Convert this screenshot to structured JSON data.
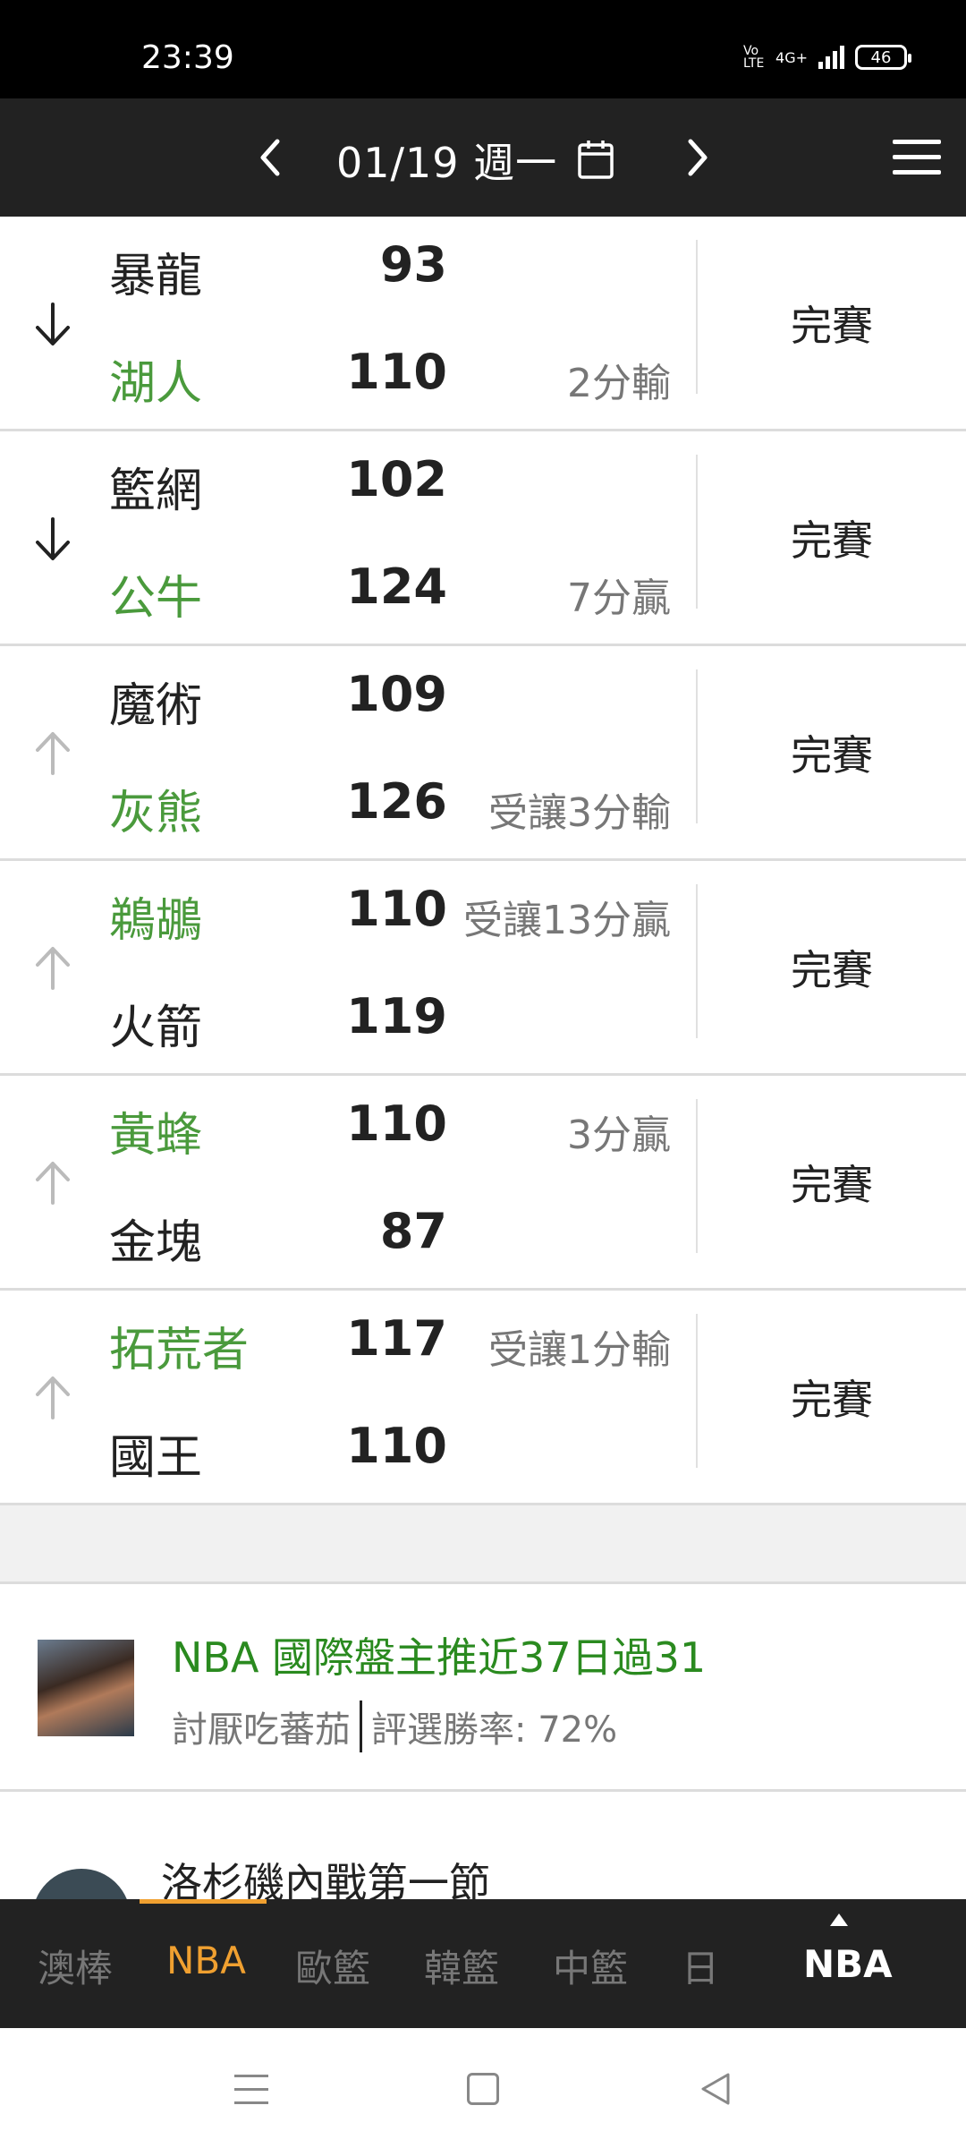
{
  "status_bar": {
    "time": "23:39",
    "network": "4G+",
    "volte": "Vo LTE",
    "battery": "46"
  },
  "header": {
    "date": "01/19 週一"
  },
  "games": [
    {
      "arrow": "down",
      "team1": "暴龍",
      "score1": "93",
      "result1": "",
      "team2": "湖人",
      "score2": "110",
      "result2": "2分輸",
      "team1_green": false,
      "team2_green": true,
      "status": "完賽"
    },
    {
      "arrow": "down",
      "team1": "籃網",
      "score1": "102",
      "result1": "",
      "team2": "公牛",
      "score2": "124",
      "result2": "7分贏",
      "team1_green": false,
      "team2_green": true,
      "status": "完賽"
    },
    {
      "arrow": "up",
      "team1": "魔術",
      "score1": "109",
      "result1": "",
      "team2": "灰熊",
      "score2": "126",
      "result2": "受讓3分輸",
      "team1_green": false,
      "team2_green": true,
      "status": "完賽"
    },
    {
      "arrow": "up",
      "team1": "鵜鶘",
      "score1": "110",
      "result1": "受讓13分贏",
      "team2": "火箭",
      "score2": "119",
      "result2": "",
      "team1_green": true,
      "team2_green": false,
      "status": "完賽"
    },
    {
      "arrow": "up",
      "team1": "黃蜂",
      "score1": "110",
      "result1": "3分贏",
      "team2": "金塊",
      "score2": "87",
      "result2": "",
      "team1_green": true,
      "team2_green": false,
      "status": "完賽"
    },
    {
      "arrow": "up",
      "team1": "拓荒者",
      "score1": "117",
      "result1": "受讓1分輸",
      "team2": "國王",
      "score2": "110",
      "result2": "",
      "team1_green": true,
      "team2_green": false,
      "status": "完賽"
    }
  ],
  "article1": {
    "title": "NBA 國際盤主推近37日過31",
    "author": "討厭吃蕃茄",
    "win_rate": "評選勝率: 72%"
  },
  "article2": {
    "title": "洛杉磯內戰第一節"
  },
  "tabbar": {
    "tabs": [
      "澳棒",
      "NBA",
      "歐籃",
      "韓籃",
      "中籃",
      "日"
    ],
    "active_index": 1,
    "current": "NBA"
  },
  "colors": {
    "green": "#4a9a3c",
    "accent": "#f0a030",
    "header_bg": "#222222"
  }
}
